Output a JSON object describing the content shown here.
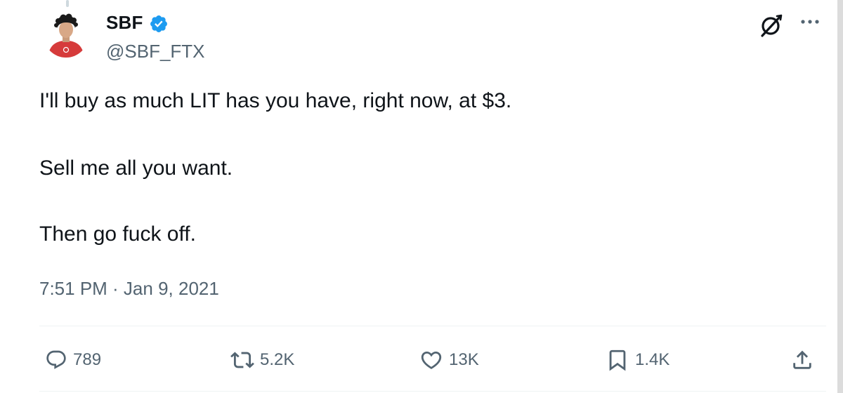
{
  "author": {
    "display_name": "SBF",
    "handle": "@SBF_FTX",
    "verified": true,
    "badge_color": "#1d9bf0"
  },
  "tweet": {
    "lines": [
      "I'll buy as much LIT has you have, right now, at $3.",
      "Sell me all you want.",
      "Then go fuck off."
    ],
    "timestamp": "7:51 PM · Jan 9, 2021"
  },
  "actions": {
    "replies": "789",
    "retweets": "5.2K",
    "likes": "13K",
    "bookmarks": "1.4K"
  },
  "icons": {
    "header": [
      "grok-icon",
      "more-icon"
    ],
    "action_bar": [
      "reply-icon",
      "retweet-icon",
      "like-icon",
      "bookmark-icon",
      "share-icon"
    ]
  },
  "colors": {
    "text": "#0f1419",
    "secondary_text": "#536471",
    "divider": "#eff3f4",
    "avatar_shirt": "#d63b3b"
  }
}
